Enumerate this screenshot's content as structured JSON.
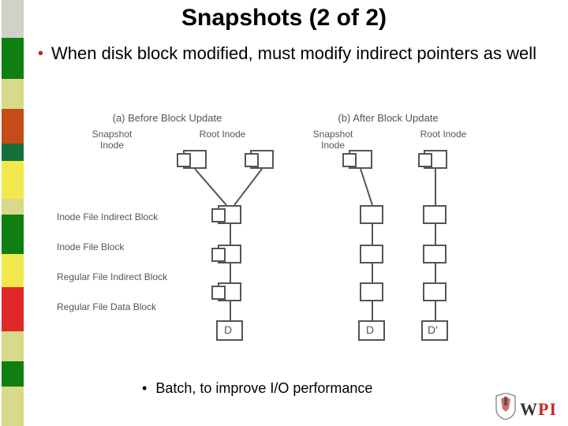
{
  "slide": {
    "title": "Snapshots (2 of 2)",
    "bullet": "When disk block modified, must modify indirect pointers as well",
    "sub_bullet": "Batch, to improve I/O performance"
  },
  "diagram": {
    "col_a": "(a) Before Block Update",
    "col_b": "(b) After Block Update",
    "top_snapshot": "Snapshot Inode",
    "top_root": "Root Inode",
    "rows": {
      "ifib": "Inode File Indirect Block",
      "ifb": "Inode File Block",
      "rfib": "Regular File Indirect Block",
      "rfdb": "Regular File Data Block"
    },
    "D": "D",
    "Dprime": "D'"
  },
  "colors": {
    "bar": [
      "#cfd2c6",
      "#0f7f0f",
      "#d8d98a",
      "#c74a19",
      "#15713a",
      "#f2e84d",
      "#d8d98a",
      "#0f7f0f",
      "#f2e84d",
      "#e02828",
      "#d8d98a",
      "#0f7f0f",
      "#d8d98a"
    ]
  },
  "logo": {
    "text1": "W",
    "text2": "P",
    "text3": "I"
  }
}
